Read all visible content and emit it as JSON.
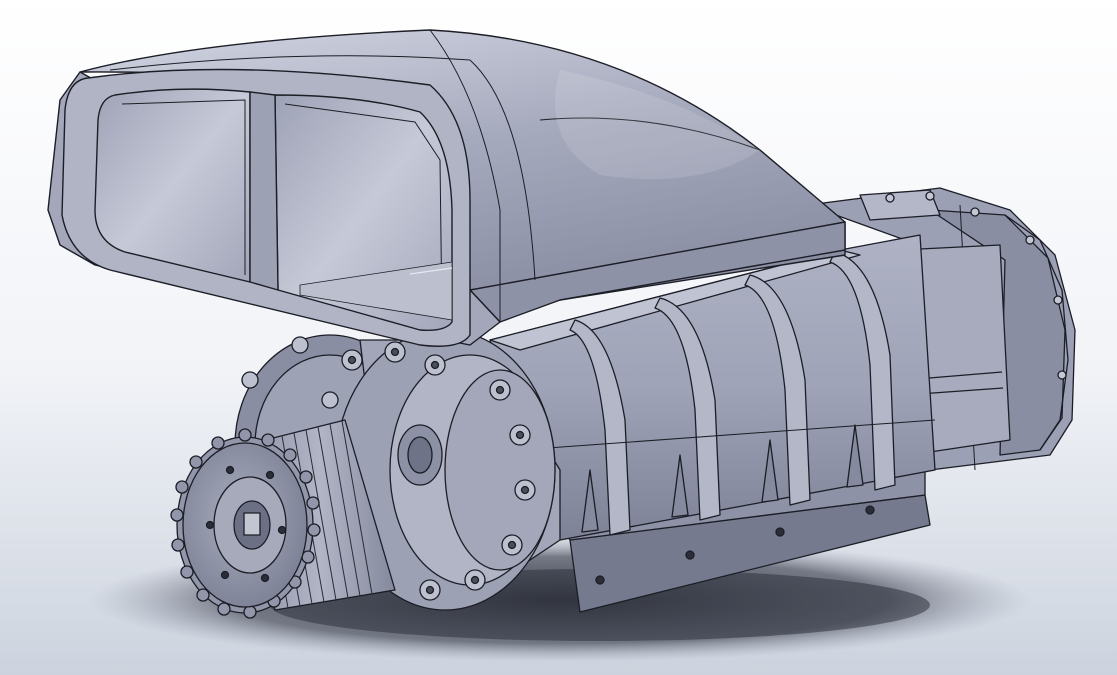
{
  "scene": {
    "subject": "supercharger-assembly-cad-render",
    "colors": {
      "background_top": "#ffffff",
      "background_bottom": "#c9d0dc",
      "body_light": "#b8bccd",
      "body_mid": "#9498ad",
      "body_dark": "#6a6e82",
      "edge_line": "#1c1d26",
      "shadow": "#3b3e4a"
    },
    "pulley_teeth_count": 26,
    "housing_ribs_count": 5,
    "bolts_count": 14
  }
}
